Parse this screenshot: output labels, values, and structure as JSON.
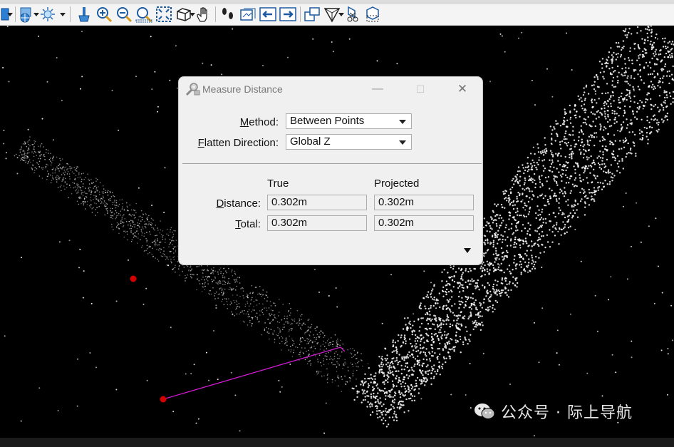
{
  "toolbar": {
    "icons": [
      "view-display-icon",
      "view-attributes-icon",
      "lighting-icon",
      "clear-icon",
      "zoom-in-icon",
      "zoom-out-icon",
      "window-area-icon",
      "fit-view-icon",
      "rotate-view-icon",
      "pan-icon",
      "walk-icon",
      "view-previous-icon",
      "view-back-icon",
      "view-forward-icon",
      "copy-view-icon",
      "clip-volume-icon",
      "clip-mask-icon",
      "clear-clip-icon"
    ]
  },
  "dialog": {
    "title": "Measure Distance",
    "minimize": "—",
    "maximize": "☐",
    "close": "✕",
    "method_label_hot": "M",
    "method_label_rest": "ethod:",
    "method_value": "Between Points",
    "flatten_label_hot": "F",
    "flatten_label_rest": "latten Direction:",
    "flatten_value": "Global Z",
    "col_true": "True",
    "col_projected": "Projected",
    "distance_label_hot": "D",
    "distance_label_rest": "istance:",
    "distance_true": "0.302m",
    "distance_projected": "0.302m",
    "total_label_hot": "T",
    "total_label_rest": "otal:",
    "total_true": "0.302m",
    "total_projected": "0.302m"
  },
  "watermark": {
    "text": "公众号 · 际上导航"
  },
  "colors": {
    "measure_line": "#d01bd0",
    "measure_point": "#d40000",
    "point_cloud": "#ffffff"
  }
}
